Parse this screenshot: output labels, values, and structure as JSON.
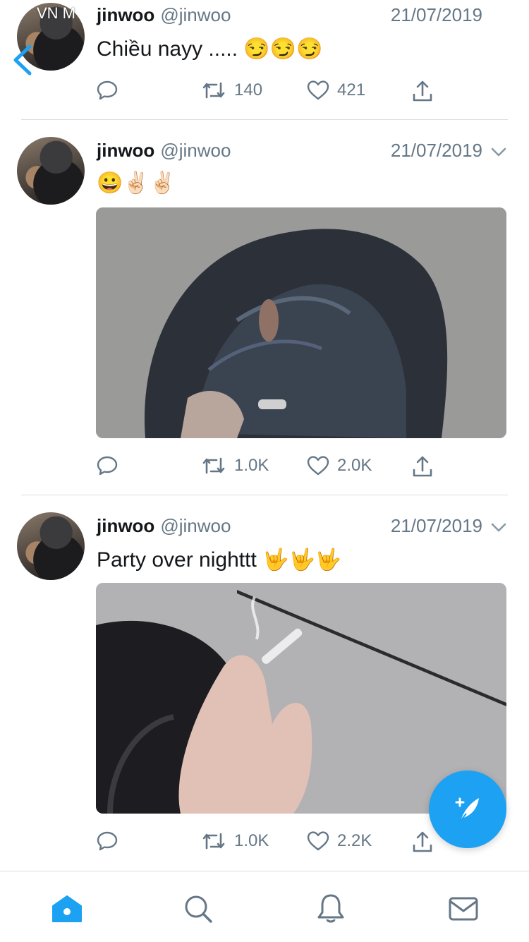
{
  "status_overlay": "VN M",
  "colors": {
    "accent": "#1da1f2",
    "secondary_text": "#657786",
    "divider": "#d8dde1"
  },
  "tweets": [
    {
      "name": "jinwoo",
      "handle": "@jinwoo",
      "date": "21/07/2019",
      "text": "Chiều nayy ..... 😏😏😏",
      "replies": "",
      "retweets": "140",
      "likes": "421"
    },
    {
      "name": "jinwoo",
      "handle": "@jinwoo",
      "date": "21/07/2019",
      "text": "😀✌🏻✌🏻",
      "replies": "",
      "retweets": "1.0K",
      "likes": "2.0K"
    },
    {
      "name": "jinwoo",
      "handle": "@jinwoo",
      "date": "21/07/2019",
      "text": "Party over nighttt 🤟🤟🤟",
      "replies": "",
      "retweets": "1.0K",
      "likes": "2.2K"
    }
  ],
  "icons": {
    "back": "chevron-left-icon",
    "reply": "reply-icon",
    "retweet": "retweet-icon",
    "like": "heart-icon",
    "share": "share-icon",
    "compose": "compose-tweet-icon",
    "caret": "chevron-down-icon",
    "tabs": [
      "home-icon",
      "search-icon",
      "notifications-icon",
      "messages-icon"
    ]
  }
}
